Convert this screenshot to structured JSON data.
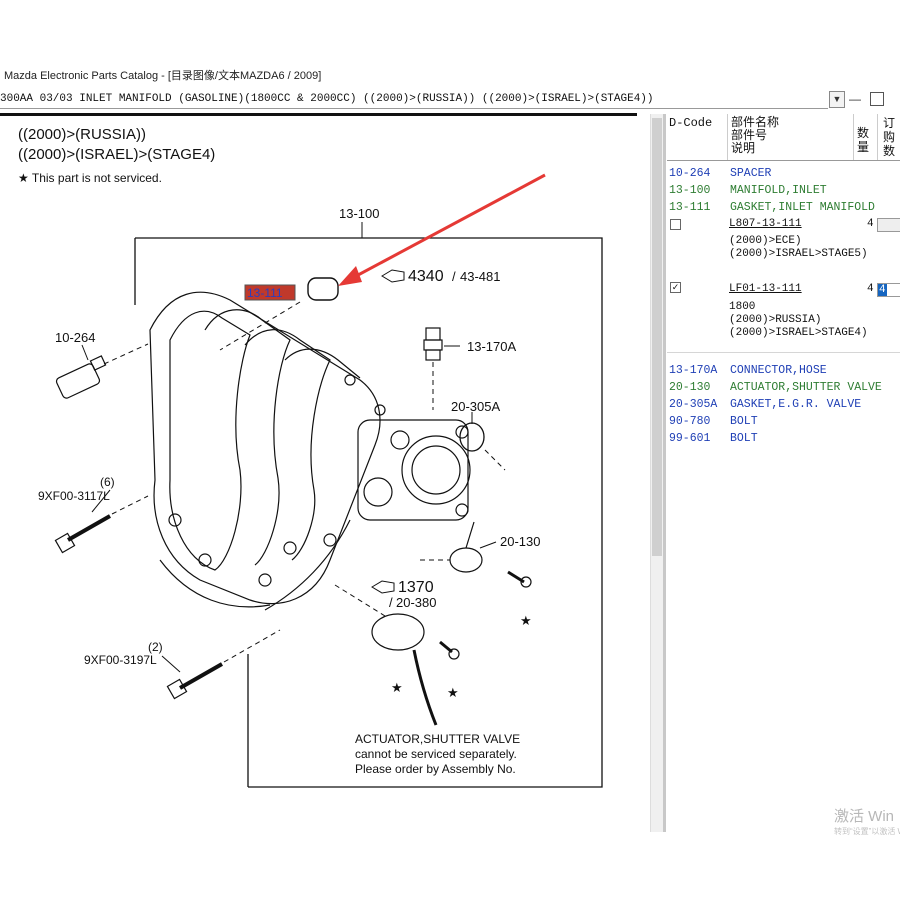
{
  "window": {
    "title": "Mazda Electronic Parts Catalog - [目录图像/文本MAZDA6 / 2009]"
  },
  "path_bar": {
    "value": "300AA 03/03 INLET MANIFOLD (GASOLINE)(1800CC & 2000CC) ((2000)>(RUSSIA)) ((2000)>(ISRAEL)>(STAGE4))"
  },
  "diagram": {
    "notes": [
      "((2000)>(RUSSIA))",
      "((2000)>(ISRAEL)>(STAGE4)"
    ],
    "service_note": "This part is not serviced.",
    "callouts": {
      "c13_100": "13-100",
      "c13_111": "13-111",
      "c4340": "4340",
      "c43_481": "43-481",
      "c13_170a": "13-170A",
      "c10_264": "10-264",
      "c20_305a": "20-305A",
      "c6": "(6)",
      "c9xf00_3117l": "9XF00-3117L",
      "c20_130": "20-130",
      "c1370": "1370",
      "c20_380": "20-380",
      "c2": "(2)",
      "c9xf00_3197l": "9XF00-3197L"
    },
    "actuator_note": [
      "ACTUATOR,SHUTTER VALVE",
      "cannot be serviced separately.",
      "Please order by Assembly No."
    ],
    "highlight_color": "#c0392b"
  },
  "parts_list": {
    "headers": {
      "dcode": "D-Code",
      "name_line1": "部件名称",
      "name_line2": "部件号",
      "name_line3": "说明",
      "qty1": "数",
      "qty2": "量",
      "order1": "订",
      "order2": "购",
      "order3": "数"
    },
    "rows": [
      {
        "code": "10-264",
        "desc": "SPACER",
        "color": "#1f3fb5"
      },
      {
        "code": "13-100",
        "desc": "MANIFOLD,INLET",
        "color": "#2e7d32"
      },
      {
        "code": "13-111",
        "desc": "GASKET,INLET MANIFOLD",
        "color": "#2e7d32"
      }
    ],
    "sub_entries": [
      {
        "checked": "",
        "part_no": "L807-13-111",
        "qty": "4",
        "order": "",
        "lines": [
          "(2000)>ECE)",
          "(2000)>ISRAEL>STAGE5)"
        ]
      },
      {
        "checked": "✓",
        "part_no": "LF01-13-111",
        "qty": "4",
        "order": "4",
        "lines": [
          "1800",
          "(2000)>RUSSIA)",
          "(2000)>ISRAEL>STAGE4)"
        ]
      }
    ],
    "rows_after": [
      {
        "code": "13-170A",
        "desc": "CONNECTOR,HOSE",
        "color": "#1f3fb5"
      },
      {
        "code": "20-130",
        "desc": "ACTUATOR,SHUTTER VALVE",
        "color": "#2e7d32"
      },
      {
        "code": "20-305A",
        "desc": "GASKET,E.G.R. VALVE",
        "color": "#1f3fb5"
      },
      {
        "code": "90-780",
        "desc": "BOLT",
        "color": "#1f3fb5"
      },
      {
        "code": "99-601",
        "desc": "BOLT",
        "color": "#1f3fb5"
      }
    ]
  },
  "watermark": {
    "line1": "激活 Win",
    "line2": "转到“设置”以激活 Windows"
  }
}
